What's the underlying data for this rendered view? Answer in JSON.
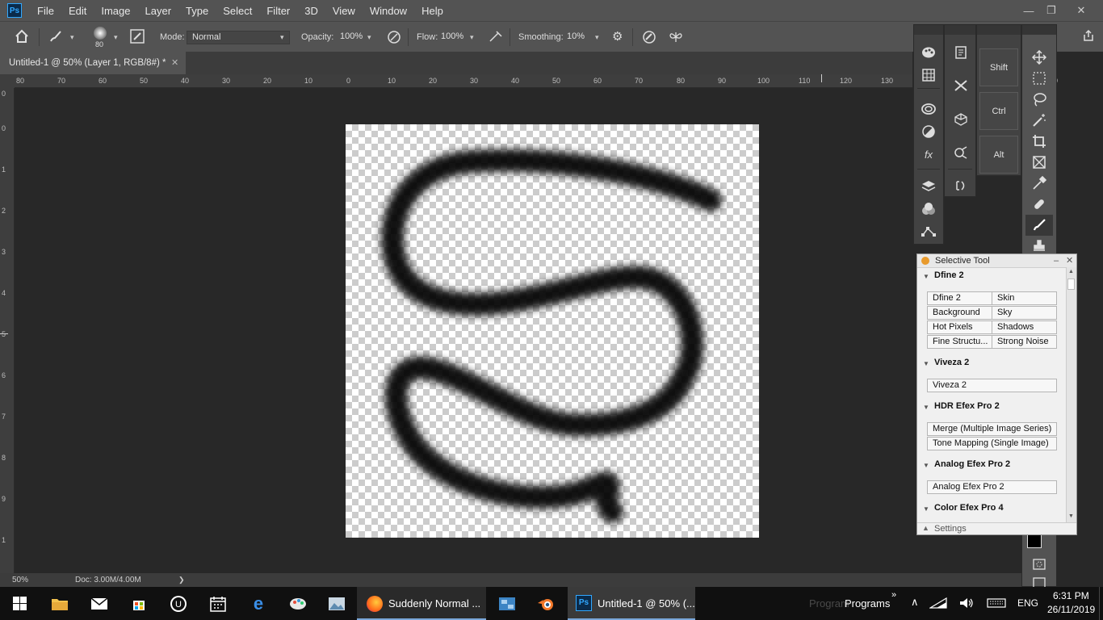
{
  "app": {
    "logo": "Ps",
    "menu": [
      "File",
      "Edit",
      "Image",
      "Layer",
      "Type",
      "Select",
      "Filter",
      "3D",
      "View",
      "Window",
      "Help"
    ],
    "window_controls": [
      "—",
      "❐",
      "✕"
    ]
  },
  "options": {
    "brush_size": "80",
    "mode_label": "Mode:",
    "mode_value": "Normal",
    "opacity_label": "Opacity:",
    "opacity_value": "100%",
    "flow_label": "Flow:",
    "flow_value": "100%",
    "smoothing_label": "Smoothing:",
    "smoothing_value": "10%"
  },
  "document": {
    "tab_title": "Untitled-1 @ 50% (Layer 1, RGB/8#) *",
    "close": "✕"
  },
  "rulers": {
    "horizontal": [
      "80",
      "70",
      "60",
      "50",
      "40",
      "30",
      "20",
      "10",
      "0",
      "10",
      "20",
      "30",
      "40",
      "50",
      "60",
      "70",
      "80",
      "90",
      "100",
      "110",
      "120",
      "130",
      "70"
    ],
    "vertical": [
      "0",
      "0",
      "1",
      "2",
      "3",
      "4",
      "5",
      "6",
      "7",
      "8",
      "9",
      "1"
    ]
  },
  "status": {
    "zoom": "50%",
    "doc": "Doc: 3.00M/4.00M",
    "arrow": "❯"
  },
  "keys": [
    "Shift",
    "Ctrl",
    "Alt"
  ],
  "selective_tool": {
    "title": "Selective Tool",
    "sections": [
      {
        "name": "Dfine 2",
        "buttons": [
          "Dfine 2",
          "Skin",
          "Background",
          "Sky",
          "Hot Pixels",
          "Shadows",
          "Fine Structu...",
          "Strong Noise"
        ]
      },
      {
        "name": "Viveza 2",
        "buttons": [
          "Viveza 2"
        ]
      },
      {
        "name": "HDR Efex Pro 2",
        "buttons": [
          "Merge (Multiple Image Series)",
          "Tone Mapping (Single Image)"
        ]
      },
      {
        "name": "Analog Efex Pro 2",
        "buttons": [
          "Analog Efex Pro 2"
        ]
      },
      {
        "name": "Color Efex Pro 4",
        "buttons": []
      }
    ],
    "settings": "Settings"
  },
  "taskbar": {
    "firefox_title": "Suddenly Normal ...",
    "ps_title": "Untitled-1 @ 50% (...",
    "programs_label": "Programs",
    "programs_ghost": "Program",
    "lang": "ENG",
    "time": "6:31 PM",
    "date": "26/11/2019"
  },
  "colors": {
    "accent": "#31a8ff",
    "panel": "#535353",
    "workspace": "#282828"
  },
  "icons": [
    "home-icon",
    "brush-icon",
    "settings-icon",
    "move-icon",
    "marquee-icon",
    "lasso-icon",
    "crop-icon",
    "eyedropper-icon",
    "heal-icon",
    "stamp-icon",
    "layers-icon",
    "windows-icon",
    "edge-icon",
    "firefox-icon",
    "blender-icon"
  ]
}
